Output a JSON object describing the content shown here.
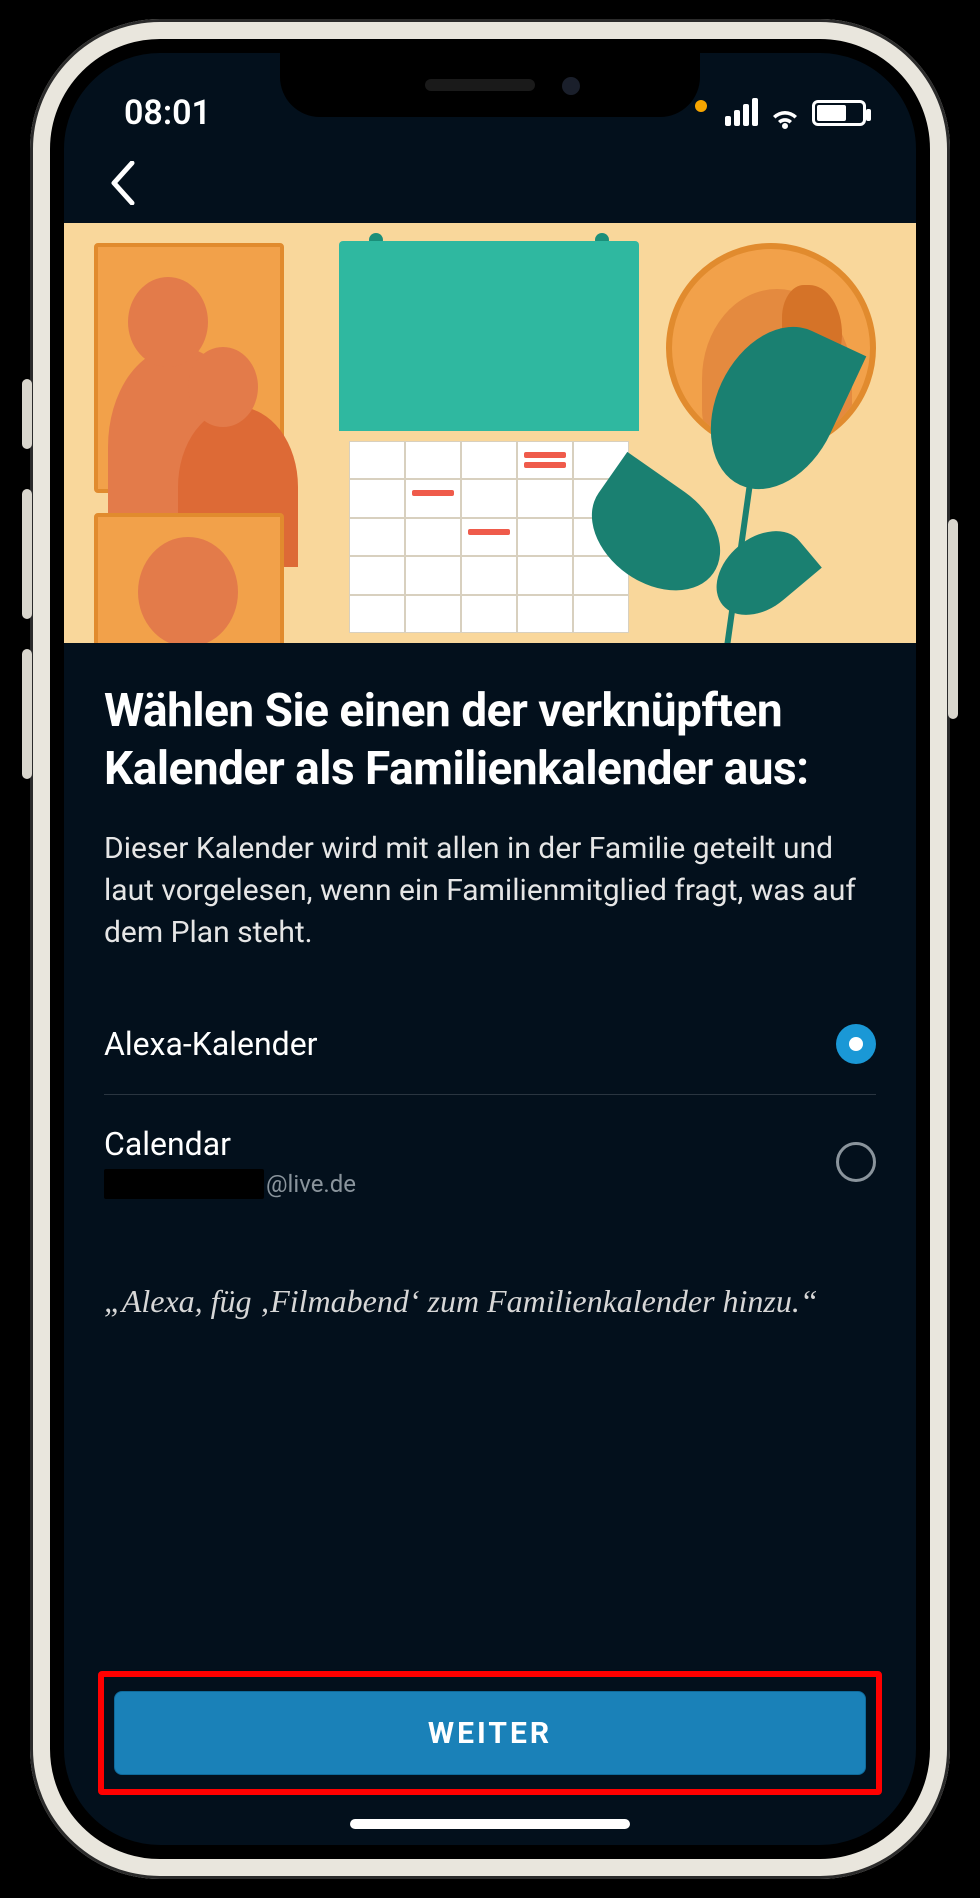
{
  "status": {
    "time": "08:01"
  },
  "nav": {
    "back_label": "Back"
  },
  "page": {
    "title": "Wählen Sie einen der verknüpften Kalender als Familienkalender aus:",
    "description": "Dieser Kalender wird mit allen in der Familie geteilt und laut vorgelesen, wenn ein Familienmitglied fragt, was auf dem Plan steht.",
    "hint": "„Alexa, füg ‚Filmabend‘ zum Familienkalender hinzu.“"
  },
  "options": [
    {
      "label": "Alexa-Kalender",
      "sub": "",
      "selected": true
    },
    {
      "label": "Calendar",
      "sub": "@live.de",
      "selected": false
    }
  ],
  "cta": {
    "label": "WEITER"
  },
  "colors": {
    "accent": "#1a98d6",
    "primary_button": "#1a81b8",
    "background": "#03101c",
    "highlight_border": "#ff0000"
  }
}
